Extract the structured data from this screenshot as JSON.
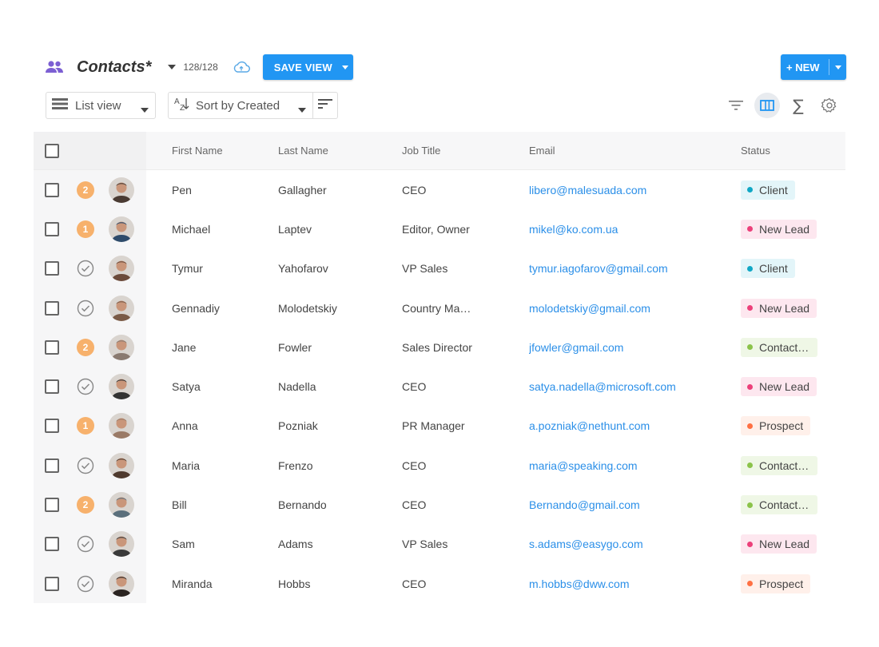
{
  "header": {
    "title": "Contacts*",
    "count": "128/128",
    "save_view_label": "SAVE VIEW",
    "new_label": "+ NEW"
  },
  "toolbar": {
    "view_label": "List view",
    "sort_label": "Sort by Created"
  },
  "table": {
    "columns": [
      "First Name",
      "Last Name",
      "Job Title",
      "Email",
      "Status"
    ],
    "rows": [
      {
        "badge": "2",
        "first": "Pen",
        "last": "Gallagher",
        "job": "CEO",
        "email": "libero@malesuada.com",
        "status": "Client"
      },
      {
        "badge": "1",
        "first": "Michael",
        "last": "Laptev",
        "job": "Editor, Owner",
        "email": "mikel@ko.com.ua",
        "status": "New Lead"
      },
      {
        "badge": "check",
        "first": "Tymur",
        "last": "Yahofarov",
        "job": "VP Sales",
        "email": "tymur.iagofarov@gmail.com",
        "status": "Client"
      },
      {
        "badge": "check",
        "first": "Gennadiy",
        "last": "Molodetskiy",
        "job": "Country Ma…",
        "email": "molodetskiy@gmail.com",
        "status": "New Lead"
      },
      {
        "badge": "2",
        "first": "Jane",
        "last": "Fowler",
        "job": "Sales Director",
        "email": "jfowler@gmail.com",
        "status": "Contacti…"
      },
      {
        "badge": "check",
        "first": "Satya",
        "last": "Nadella",
        "job": "CEO",
        "email": "satya.nadella@microsoft.com",
        "status": "New Lead"
      },
      {
        "badge": "1",
        "first": "Anna",
        "last": "Pozniak",
        "job": "PR Manager",
        "email": "a.pozniak@nethunt.com",
        "status": "Prospect"
      },
      {
        "badge": "check",
        "first": "Maria",
        "last": "Frenzo",
        "job": "CEO",
        "email": "maria@speaking.com",
        "status": "Contacti…"
      },
      {
        "badge": "2",
        "first": "Bill",
        "last": "Bernando",
        "job": "CEO",
        "email": "Bernando@gmail.com",
        "status": "Contacti…"
      },
      {
        "badge": "check",
        "first": "Sam",
        "last": "Adams",
        "job": "VP Sales",
        "email": "s.adams@easygo.com",
        "status": "New Lead"
      },
      {
        "badge": "check",
        "first": "Miranda",
        "last": "Hobbs",
        "job": "CEO",
        "email": "m.hobbs@dww.com",
        "status": "Prospect"
      }
    ]
  },
  "status_colors": {
    "Client": {
      "dot": "#10a7c5",
      "bg": "#e3f5f9"
    },
    "New Lead": {
      "dot": "#ec407a",
      "bg": "#fde7ef"
    },
    "Contacti…": {
      "dot": "#8bc34a",
      "bg": "#eff7e6"
    },
    "Prospect": {
      "dot": "#ff7043",
      "bg": "#fff0ea"
    }
  },
  "colors": {
    "accent": "#2196f3",
    "link": "#2b8fe8",
    "badge": "#f7b16c",
    "people_icon": "#7c5fd3"
  }
}
